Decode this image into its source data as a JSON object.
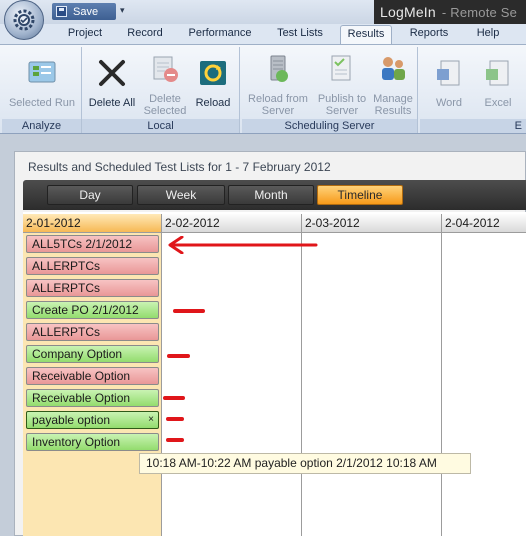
{
  "titlebar": {
    "save_label": "Save",
    "dropdown_glyph": "▾",
    "logmein_label": "LogMeIn",
    "remote_label": "- Remote Se"
  },
  "tabs": [
    "Project",
    "Record",
    "Performance",
    "Test Lists",
    "Results",
    "Reports",
    "Help"
  ],
  "active_tab": "Results",
  "ribbon": {
    "groups": {
      "analyze": "Analyze",
      "local": "Local",
      "scheduling": "Scheduling Server",
      "export": "E"
    },
    "buttons": {
      "selected_run": "Selected Run",
      "delete_all": "Delete All",
      "delete_selected_1": "Delete",
      "delete_selected_2": "Selected",
      "reload": "Reload",
      "reload_server_1": "Reload from",
      "reload_server_2": "Server",
      "publish_1": "Publish to",
      "publish_2": "Server",
      "manage_1": "Manage",
      "manage_2": "Results",
      "word": "Word",
      "excel": "Excel"
    }
  },
  "panel": {
    "title": "Results and Scheduled Test Lists for  1 - 7 February 2012",
    "views": [
      "Day",
      "Week",
      "Month",
      "Timeline"
    ],
    "active_view": "Timeline",
    "days": [
      "2-01-2012",
      "2-02-2012",
      "2-03-2012",
      "2-04-2012"
    ],
    "events": [
      {
        "label": "ALL5TCs 2/1/2012",
        "status": "red"
      },
      {
        "label": "ALLERPTCs",
        "status": "red"
      },
      {
        "label": "ALLERPTCs",
        "status": "red"
      },
      {
        "label": "Create PO 2/1/2012",
        "status": "green"
      },
      {
        "label": "ALLERPTCs",
        "status": "red"
      },
      {
        "label": "Company Option",
        "status": "green"
      },
      {
        "label": "Receivable Option",
        "status": "red"
      },
      {
        "label": "Receivable Option",
        "status": "green"
      },
      {
        "label": "payable option",
        "status": "green",
        "close": "×"
      },
      {
        "label": "Inventory Option",
        "status": "green"
      }
    ]
  },
  "tooltip": "10:18 AM-10:22 AM payable option 2/1/2012 10:18 AM",
  "colors": {
    "annotation": "#e0161a",
    "event_red": "#e99797",
    "event_green": "#93dc6e",
    "timeline_active": "#f79a1a"
  }
}
